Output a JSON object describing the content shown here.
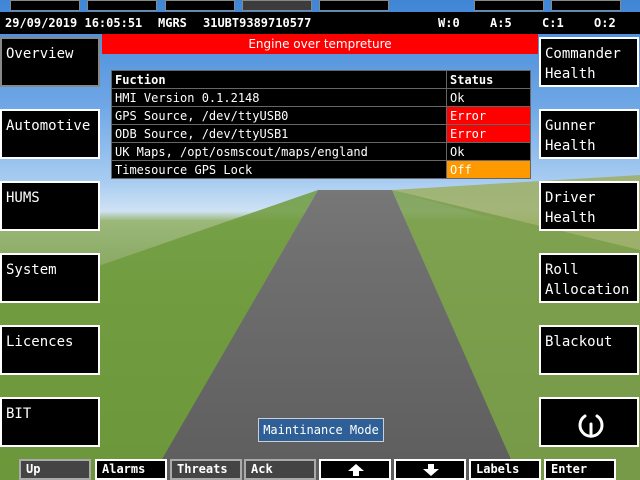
{
  "top_tabs": [
    {
      "id": "tab-1",
      "active": false
    },
    {
      "id": "tab-2",
      "active": false
    },
    {
      "id": "tab-3",
      "active": false
    },
    {
      "id": "tab-4",
      "active": true
    },
    {
      "id": "tab-5",
      "active": false
    },
    {
      "id": "tab-6",
      "active": false
    },
    {
      "id": "tab-7",
      "active": false
    }
  ],
  "status_bar": {
    "datetime": "29/09/2019 16:05:51",
    "grid_system": "MGRS",
    "grid_ref": "31UBT9389710577",
    "w": "W:0",
    "a": "A:5",
    "c": "C:1",
    "o": "O:2"
  },
  "alarm_banner": "Engine over tempreture",
  "left_keys": [
    "Overview",
    "Automotive",
    "HUMS",
    "System",
    "Licences",
    "BIT"
  ],
  "right_keys": [
    "Commander Health",
    "Gunner Health",
    "Driver Health",
    "Roll Allocation",
    "Blackout",
    "power-icon"
  ],
  "table": {
    "headers": [
      "Fuction",
      "Status"
    ],
    "rows": [
      {
        "name": "HMI Version 0.1.2148",
        "status": "Ok",
        "status_color": "#000000"
      },
      {
        "name": "GPS Source, /dev/ttyUSB0",
        "status": "Error",
        "status_color": "#ff0000"
      },
      {
        "name": "ODB Source, /dev/ttyUSB1",
        "status": "Error",
        "status_color": "#ff0000"
      },
      {
        "name": "UK Maps, /opt/osmscout/maps/england",
        "status": "Ok",
        "status_color": "#000000"
      },
      {
        "name": "Timesource GPS Lock",
        "status": "Off",
        "status_color": "#ff9900"
      }
    ]
  },
  "mode_label": "Maintinance Mode",
  "bottom_keys": [
    {
      "label": "Up",
      "dim": true
    },
    {
      "label": "Alarms",
      "dim": false
    },
    {
      "label": "Threats",
      "dim": true
    },
    {
      "label": "Ack",
      "dim": true
    },
    {
      "label": "",
      "icon": "arrow-up-icon",
      "dim": false
    },
    {
      "label": "",
      "icon": "arrow-down-icon",
      "dim": false
    },
    {
      "label": "Labels",
      "dim": false
    },
    {
      "label": "Enter",
      "dim": false
    }
  ]
}
